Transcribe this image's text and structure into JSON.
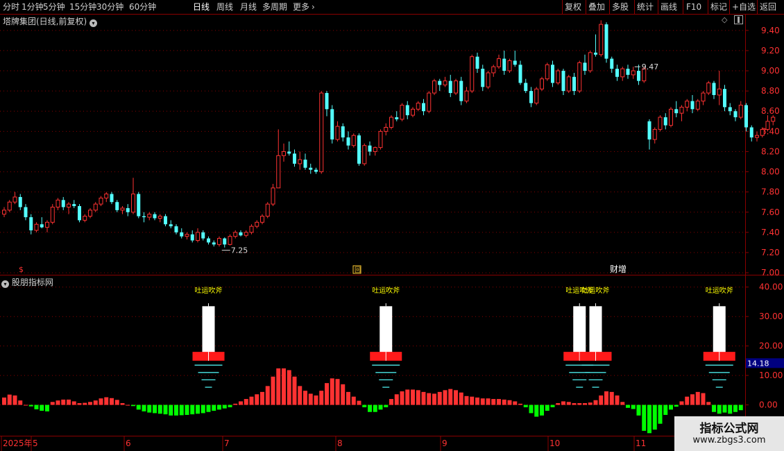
{
  "toolbar": {
    "left": [
      {
        "label": "分时",
        "active": false
      },
      {
        "label": "1分钟",
        "active": false
      },
      {
        "label": "5分钟",
        "active": false
      },
      {
        "label": "15分钟",
        "active": false
      },
      {
        "label": "30分钟",
        "active": false
      },
      {
        "label": "60分钟",
        "active": false
      },
      {
        "label": "日线",
        "active": true
      },
      {
        "label": "周线",
        "active": false
      },
      {
        "label": "月线",
        "active": false
      },
      {
        "label": "多周期",
        "active": false
      },
      {
        "label": "更多",
        "active": false
      }
    ],
    "more_icon": "chevron-right-icon",
    "right": [
      "复权",
      "叠加",
      "多股",
      "统计",
      "画线",
      "F10",
      "标记",
      "+自选",
      "返回"
    ]
  },
  "main_pane": {
    "title": "塔牌集团(日线,前复权)",
    "title_icon": "chevron-down-icon",
    "icons": [
      "diamond-icon",
      "scroll-icon"
    ],
    "high_marker": "9.47",
    "low_marker": "7.25",
    "markers": [
      "$",
      "回",
      "财增"
    ]
  },
  "indicator_pane": {
    "title": "股朋指标网",
    "title_icon": "chevron-down-icon",
    "signal_label": "吐运吹斧",
    "current_value": "14.18"
  },
  "x_axis": {
    "labels": [
      "2025年",
      "5",
      "6",
      "7",
      "8",
      "9",
      "10",
      "11"
    ]
  },
  "watermark": {
    "line1": "指标公式网",
    "line2": "www.zbgs3.com"
  },
  "colors": {
    "up": "#ff3232",
    "down": "#54ffff",
    "grid": "#8b0000",
    "axis_text": "#ff3232",
    "background": "#000000",
    "signal": "#ffff00",
    "volume_down": "#00ff00"
  },
  "chart_data": [
    {
      "type": "candlestick",
      "title": "塔牌集团(日线,前复权)",
      "x_start": "2025-04-24",
      "y_ticks": [
        "7.00",
        "7.20",
        "7.40",
        "7.60",
        "7.80",
        "8.00",
        "8.20",
        "8.40",
        "8.60",
        "8.80",
        "9.00",
        "9.20",
        "9.40"
      ],
      "ylim": [
        6.98,
        9.55
      ],
      "annotations": [
        {
          "label": "9.47",
          "index": 117
        },
        {
          "label": "7.25",
          "index": 41
        }
      ],
      "ohlc": [
        [
          7.58,
          7.65,
          7.55,
          7.62
        ],
        [
          7.62,
          7.72,
          7.6,
          7.7
        ],
        [
          7.7,
          7.8,
          7.68,
          7.75
        ],
        [
          7.75,
          7.78,
          7.62,
          7.65
        ],
        [
          7.65,
          7.68,
          7.52,
          7.55
        ],
        [
          7.55,
          7.58,
          7.38,
          7.42
        ],
        [
          7.42,
          7.5,
          7.4,
          7.48
        ],
        [
          7.48,
          7.55,
          7.44,
          7.45
        ],
        [
          7.45,
          7.52,
          7.4,
          7.5
        ],
        [
          7.5,
          7.68,
          7.48,
          7.65
        ],
        [
          7.65,
          7.74,
          7.62,
          7.72
        ],
        [
          7.72,
          7.75,
          7.62,
          7.65
        ],
        [
          7.65,
          7.7,
          7.58,
          7.68
        ],
        [
          7.68,
          7.72,
          7.64,
          7.66
        ],
        [
          7.66,
          7.68,
          7.5,
          7.52
        ],
        [
          7.52,
          7.58,
          7.5,
          7.56
        ],
        [
          7.56,
          7.64,
          7.54,
          7.62
        ],
        [
          7.62,
          7.7,
          7.6,
          7.68
        ],
        [
          7.68,
          7.76,
          7.66,
          7.74
        ],
        [
          7.74,
          7.8,
          7.7,
          7.78
        ],
        [
          7.78,
          7.8,
          7.68,
          7.7
        ],
        [
          7.7,
          7.72,
          7.6,
          7.62
        ],
        [
          7.62,
          7.66,
          7.58,
          7.64
        ],
        [
          7.64,
          7.68,
          7.56,
          7.6
        ],
        [
          7.6,
          7.94,
          7.58,
          7.78
        ],
        [
          7.78,
          7.8,
          7.54,
          7.56
        ],
        [
          7.56,
          7.6,
          7.5,
          7.55
        ],
        [
          7.55,
          7.6,
          7.52,
          7.58
        ],
        [
          7.58,
          7.6,
          7.52,
          7.54
        ],
        [
          7.54,
          7.58,
          7.5,
          7.56
        ],
        [
          7.56,
          7.58,
          7.46,
          7.48
        ],
        [
          7.48,
          7.52,
          7.44,
          7.46
        ],
        [
          7.46,
          7.48,
          7.38,
          7.4
        ],
        [
          7.4,
          7.44,
          7.34,
          7.36
        ],
        [
          7.36,
          7.4,
          7.33,
          7.38
        ],
        [
          7.38,
          7.42,
          7.3,
          7.32
        ],
        [
          7.32,
          7.44,
          7.3,
          7.4
        ],
        [
          7.4,
          7.42,
          7.32,
          7.34
        ],
        [
          7.34,
          7.36,
          7.28,
          7.3
        ],
        [
          7.3,
          7.32,
          7.26,
          7.28
        ],
        [
          7.28,
          7.36,
          7.26,
          7.34
        ],
        [
          7.34,
          7.35,
          7.25,
          7.28
        ],
        [
          7.28,
          7.38,
          7.27,
          7.36
        ],
        [
          7.36,
          7.42,
          7.34,
          7.4
        ],
        [
          7.4,
          7.42,
          7.36,
          7.37
        ],
        [
          7.37,
          7.42,
          7.35,
          7.4
        ],
        [
          7.4,
          7.48,
          7.38,
          7.46
        ],
        [
          7.46,
          7.52,
          7.44,
          7.5
        ],
        [
          7.5,
          7.58,
          7.48,
          7.56
        ],
        [
          7.56,
          7.7,
          7.54,
          7.68
        ],
        [
          7.68,
          7.88,
          7.66,
          7.84
        ],
        [
          7.84,
          8.42,
          8.08,
          8.16
        ],
        [
          8.16,
          8.28,
          8.1,
          8.2
        ],
        [
          8.2,
          8.3,
          8.16,
          8.18
        ],
        [
          8.18,
          8.22,
          8.05,
          8.08
        ],
        [
          8.08,
          8.2,
          8.02,
          8.12
        ],
        [
          8.12,
          8.18,
          8.02,
          8.04
        ],
        [
          8.04,
          8.08,
          7.98,
          8.02
        ],
        [
          8.02,
          8.04,
          7.98,
          8.0
        ],
        [
          8.0,
          8.8,
          7.98,
          8.78
        ],
        [
          8.78,
          8.8,
          8.55,
          8.62
        ],
        [
          8.62,
          8.66,
          8.28,
          8.32
        ],
        [
          8.32,
          8.5,
          8.3,
          8.45
        ],
        [
          8.45,
          8.48,
          8.3,
          8.34
        ],
        [
          8.34,
          8.4,
          8.22,
          8.26
        ],
        [
          8.26,
          8.38,
          8.24,
          8.36
        ],
        [
          8.36,
          8.38,
          8.06,
          8.08
        ],
        [
          8.08,
          8.28,
          8.06,
          8.26
        ],
        [
          8.26,
          8.3,
          8.16,
          8.2
        ],
        [
          8.2,
          8.25,
          8.16,
          8.24
        ],
        [
          8.24,
          8.42,
          8.22,
          8.4
        ],
        [
          8.4,
          8.48,
          8.36,
          8.44
        ],
        [
          8.44,
          8.56,
          8.42,
          8.54
        ],
        [
          8.54,
          8.6,
          8.5,
          8.52
        ],
        [
          8.52,
          8.68,
          8.5,
          8.66
        ],
        [
          8.66,
          8.7,
          8.52,
          8.56
        ],
        [
          8.56,
          8.64,
          8.54,
          8.62
        ],
        [
          8.62,
          8.7,
          8.6,
          8.68
        ],
        [
          8.68,
          8.72,
          8.56,
          8.6
        ],
        [
          8.6,
          8.8,
          8.58,
          8.78
        ],
        [
          8.78,
          8.92,
          8.76,
          8.9
        ],
        [
          8.9,
          8.92,
          8.8,
          8.86
        ],
        [
          8.86,
          8.94,
          8.84,
          8.9
        ],
        [
          8.9,
          8.96,
          8.74,
          8.78
        ],
        [
          8.78,
          8.92,
          8.76,
          8.9
        ],
        [
          8.9,
          8.94,
          8.66,
          8.7
        ],
        [
          8.7,
          8.84,
          8.68,
          8.8
        ],
        [
          8.8,
          9.16,
          8.78,
          9.14
        ],
        [
          9.14,
          9.18,
          8.98,
          9.02
        ],
        [
          9.02,
          9.06,
          8.8,
          8.84
        ],
        [
          8.84,
          9.0,
          8.82,
          8.98
        ],
        [
          8.98,
          9.06,
          8.94,
          9.04
        ],
        [
          9.04,
          9.16,
          9.02,
          9.12
        ],
        [
          9.12,
          9.2,
          8.96,
          9.0
        ],
        [
          9.0,
          9.12,
          8.98,
          9.1
        ],
        [
          9.1,
          9.2,
          9.04,
          9.06
        ],
        [
          9.06,
          9.1,
          8.86,
          8.88
        ],
        [
          8.88,
          8.92,
          8.78,
          8.8
        ],
        [
          8.8,
          8.84,
          8.64,
          8.68
        ],
        [
          8.68,
          8.84,
          8.66,
          8.82
        ],
        [
          8.82,
          8.94,
          8.8,
          8.92
        ],
        [
          8.92,
          9.08,
          8.9,
          9.06
        ],
        [
          9.06,
          9.1,
          8.84,
          8.88
        ],
        [
          8.88,
          9.02,
          8.86,
          9.0
        ],
        [
          9.0,
          9.02,
          8.76,
          8.8
        ],
        [
          8.8,
          8.96,
          8.78,
          8.94
        ],
        [
          8.94,
          8.98,
          8.76,
          8.8
        ],
        [
          8.8,
          9.1,
          8.78,
          9.08
        ],
        [
          9.08,
          9.16,
          8.96,
          9.0
        ],
        [
          9.0,
          9.2,
          8.98,
          9.18
        ],
        [
          9.18,
          9.36,
          9.14,
          9.16
        ],
        [
          9.16,
          9.5,
          9.14,
          9.46
        ],
        [
          9.46,
          9.48,
          9.08,
          9.12
        ],
        [
          9.12,
          9.14,
          8.98,
          9.02
        ],
        [
          9.02,
          9.06,
          8.9,
          8.94
        ],
        [
          8.94,
          9.04,
          8.9,
          9.02
        ],
        [
          9.02,
          9.06,
          8.92,
          8.96
        ],
        [
          8.96,
          9.04,
          8.92,
          9.0
        ],
        [
          9.0,
          9.06,
          8.86,
          8.9
        ],
        [
          8.9,
          9.04,
          8.88,
          9.02
        ],
        [
          8.5,
          8.52,
          8.22,
          8.32
        ],
        [
          8.32,
          8.44,
          8.28,
          8.42
        ],
        [
          8.42,
          8.56,
          8.4,
          8.54
        ],
        [
          8.54,
          8.58,
          8.42,
          8.46
        ],
        [
          8.46,
          8.64,
          8.44,
          8.62
        ],
        [
          8.62,
          8.7,
          8.54,
          8.58
        ],
        [
          8.58,
          8.66,
          8.5,
          8.64
        ],
        [
          8.64,
          8.72,
          8.6,
          8.7
        ],
        [
          8.7,
          8.76,
          8.58,
          8.62
        ],
        [
          8.62,
          8.72,
          8.6,
          8.7
        ],
        [
          8.7,
          8.8,
          8.66,
          8.78
        ],
        [
          8.78,
          8.9,
          8.76,
          8.88
        ],
        [
          8.88,
          8.9,
          8.72,
          8.76
        ],
        [
          8.76,
          9.0,
          8.66,
          8.82
        ],
        [
          8.82,
          8.86,
          8.6,
          8.64
        ],
        [
          8.64,
          8.68,
          8.56,
          8.6
        ],
        [
          8.6,
          8.62,
          8.5,
          8.54
        ],
        [
          8.54,
          8.7,
          8.52,
          8.66
        ],
        [
          8.66,
          8.68,
          8.4,
          8.44
        ],
        [
          8.44,
          8.46,
          8.3,
          8.34
        ],
        [
          8.34,
          8.4,
          8.3,
          8.36
        ],
        [
          8.36,
          8.44,
          8.34,
          8.42
        ],
        [
          8.42,
          8.56,
          8.4,
          8.5
        ],
        [
          8.5,
          8.56,
          8.46,
          8.54
        ]
      ]
    },
    {
      "type": "bar",
      "title": "股朋指标网",
      "y_ticks": [
        "40.00",
        "30.00",
        "20.00",
        "10.00",
        "0.00"
      ],
      "ylim": [
        -10,
        43
      ],
      "current_value": 14.18,
      "values": [
        2.5,
        3.5,
        3.2,
        1.5,
        0,
        -0.5,
        -1.5,
        -2.0,
        -2.2,
        1.0,
        1.5,
        1.8,
        1.8,
        1.2,
        0.6,
        0.7,
        1.0,
        1.5,
        2.2,
        2.6,
        2.3,
        1.7,
        0.6,
        0,
        -0.4,
        -1.6,
        -2.2,
        -2.6,
        -2.8,
        -3.0,
        -3.2,
        -3.6,
        -3.6,
        -3.5,
        -3.4,
        -3.2,
        -3.0,
        -2.8,
        -2.4,
        -2.0,
        -1.6,
        -1.2,
        -0.8,
        0.4,
        1.2,
        2.0,
        2.8,
        3.6,
        4.4,
        6.4,
        9.6,
        12.4,
        12.4,
        11.8,
        9.6,
        6.4,
        4.8,
        3.8,
        3.2,
        4.8,
        7.4,
        9.0,
        8.8,
        7.0,
        4.4,
        2.8,
        1.4,
        -0.8,
        -2.4,
        -2.4,
        -1.6,
        -0.8,
        2.0,
        3.6,
        4.6,
        5.2,
        5.2,
        5.0,
        4.4,
        4.0,
        3.8,
        4.4,
        5.0,
        5.4,
        5.0,
        4.2,
        3.0,
        2.8,
        2.5,
        2.2,
        2.2,
        2.0,
        2.0,
        1.8,
        1.6,
        1.2,
        0.4,
        -0.8,
        -2.8,
        -4.0,
        -3.6,
        -2.0,
        -0.8,
        0.6,
        1.2,
        1.0,
        0.6,
        0.6,
        0.6,
        0.8,
        1.6,
        3.2,
        4.6,
        4.4,
        3.2,
        1.0,
        -1.0,
        -1.4,
        -3.6,
        -8.8,
        -9.6,
        -8.4,
        -6.4,
        -3.4,
        -1.6,
        -0.6,
        1.2,
        2.8,
        3.6,
        4.4,
        4.0,
        1.0,
        -2.4,
        -3.0,
        -2.6,
        -3.0,
        -2.4,
        -1.8
      ],
      "signals": [
        {
          "label": "吐运吹斧",
          "index": 38
        },
        {
          "label": "吐运吹斧",
          "index": 71
        },
        {
          "label": "吐运吹斧",
          "index": 107
        },
        {
          "label": "吐运吹斧",
          "index": 110
        },
        {
          "label": "吐运吹斧",
          "index": 133
        }
      ]
    }
  ]
}
